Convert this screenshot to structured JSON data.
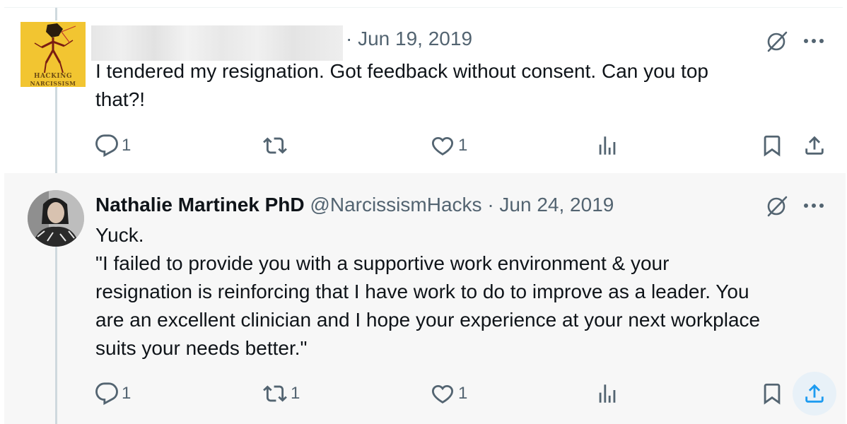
{
  "tweet1": {
    "avatar_text": [
      "HACKING",
      "NARCISSISM"
    ],
    "date": "· Jun 19, 2019",
    "text": "I tendered my resignation. Got feedback without consent. Can you top\nthat?!",
    "actions": {
      "reply_count": "1",
      "retweet_count": "",
      "like_count": "1"
    }
  },
  "tweet2": {
    "display_name": "Nathalie Martinek PhD",
    "handle": "@NarcissismHacks",
    "date": "· Jun 24, 2019",
    "text": "Yuck.\n\"I failed to provide you with a supportive work environment & your\nresignation is reinforcing that I have work to do to improve as a leader. You\nare an excellent clinician and I hope your experience at your next workplace\nsuits your needs better.\"",
    "actions": {
      "reply_count": "1",
      "retweet_count": "1",
      "like_count": "1"
    }
  },
  "icons": {
    "reply": "reply-icon",
    "retweet": "retweet-icon",
    "like": "heart-icon",
    "views": "analytics-icon",
    "bookmark": "bookmark-icon",
    "share": "share-icon",
    "grok": "grok-icon",
    "more": "more-icon"
  },
  "colors": {
    "muted_text": "#536471",
    "share_active": "#1d9bf0",
    "selected_bg": "#f7f7f7",
    "avatar_yellow": "#f2c531"
  }
}
